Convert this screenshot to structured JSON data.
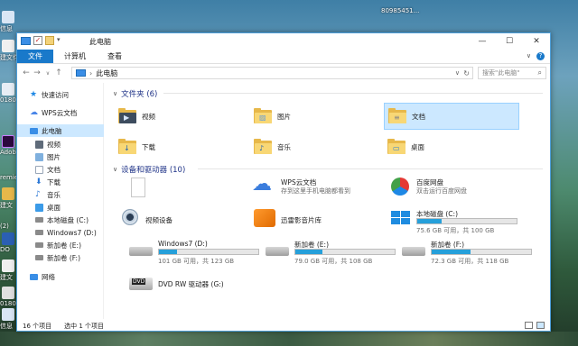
{
  "desktop": {
    "left_labels": [
      "信息",
      "建文件",
      "0180",
      "Adob",
      "remie",
      "建文",
      "(2)",
      "DO",
      "建文",
      "0180",
      "信息",
      "0180"
    ],
    "top_label": "80985451..."
  },
  "window": {
    "title": "此电脑",
    "controls": {
      "minimize": "—",
      "maximize": "☐",
      "close": "✕"
    },
    "ribbon_tabs": [
      "文件",
      "计算机",
      "查看"
    ],
    "ribbon_right": {
      "expand": "∨",
      "help": "?"
    },
    "nav_buttons": {
      "back": "←",
      "forward": "→",
      "recent": "∨",
      "up": "↑"
    },
    "address": {
      "separator": "›",
      "location": "此电脑",
      "dropdown": "∨",
      "refresh": "↻"
    },
    "search": {
      "placeholder": "搜索\"此电脑\"",
      "icon": "⌕"
    }
  },
  "nav_pane": {
    "items": [
      {
        "label": "快速访问",
        "icon": "star-icon",
        "color": "#1e88e5"
      },
      {
        "label": "WPS云文档",
        "icon": "cloud-icon",
        "color": "#4a86e8"
      },
      {
        "label": "此电脑",
        "icon": "computer-icon",
        "color": "#3a8ee6",
        "selected": true
      },
      {
        "label": "视频",
        "icon": "video-folder-icon",
        "color": "#5f6b7a"
      },
      {
        "label": "图片",
        "icon": "pictures-folder-icon",
        "color": "#7fb0de"
      },
      {
        "label": "文档",
        "icon": "documents-folder-icon",
        "color": "#9aa7b8"
      },
      {
        "label": "下载",
        "icon": "download-icon",
        "color": "#2b78d6"
      },
      {
        "label": "音乐",
        "icon": "music-icon",
        "color": "#2b78d6"
      },
      {
        "label": "桌面",
        "icon": "desktop-folder-icon",
        "color": "#3b9be8"
      },
      {
        "label": "本地磁盘 (C:)",
        "icon": "drive-icon",
        "color": "#8a8a8a"
      },
      {
        "label": "Windows7 (D:)",
        "icon": "drive-icon",
        "color": "#8a8a8a"
      },
      {
        "label": "新加卷 (E:)",
        "icon": "drive-icon",
        "color": "#8a8a8a"
      },
      {
        "label": "新加卷 (F:)",
        "icon": "drive-icon",
        "color": "#8a8a8a"
      },
      {
        "label": "网络",
        "icon": "network-icon",
        "color": "#3a8ee6"
      }
    ]
  },
  "folders_group": {
    "title": "文件夹 (6)",
    "items": [
      {
        "label": "视频",
        "glyph": "▶",
        "selected": false
      },
      {
        "label": "图片",
        "glyph": "▨",
        "selected": false
      },
      {
        "label": "文档",
        "glyph": "≡",
        "selected": true
      },
      {
        "label": "下载",
        "glyph": "↓",
        "selected": false
      },
      {
        "label": "音乐",
        "glyph": "♪",
        "selected": false
      },
      {
        "label": "桌面",
        "glyph": "▭",
        "selected": false
      }
    ]
  },
  "devices_group": {
    "title": "设备和驱动器 (10)",
    "items": [
      {
        "name": "",
        "icon": "blank-document-icon"
      },
      {
        "name": "WPS云文档",
        "subtitle": "存到这里手机电脑都看到",
        "icon": "wps-cloud-icon"
      },
      {
        "name": "百度网盘",
        "subtitle": "双击运行百度网盘",
        "icon": "baidu-netdisk-icon"
      },
      {
        "name": "视频设备",
        "icon": "webcam-icon"
      },
      {
        "name": "迅雷影音片库",
        "icon": "xunlei-icon"
      },
      {
        "name": "本地磁盘 (C:)",
        "size": "75.6 GB 可用，共 100 GB",
        "fraction_used": 0.244,
        "icon": "windows-drive-icon"
      },
      {
        "name": "Windows7 (D:)",
        "size": "101 GB 可用，共 123 GB",
        "fraction_used": 0.179,
        "icon": "drive-icon"
      },
      {
        "name": "新加卷 (E:)",
        "size": "79.0 GB 可用，共 108 GB",
        "fraction_used": 0.269,
        "icon": "drive-icon"
      },
      {
        "name": "新加卷 (F:)",
        "size": "72.3 GB 可用，共 118 GB",
        "fraction_used": 0.387,
        "icon": "drive-icon"
      },
      {
        "name": "DVD RW 驱动器 (G:)",
        "icon": "dvd-drive-icon",
        "icon_text": "DVD"
      }
    ]
  },
  "status": {
    "count": "16 个项目",
    "selected": "选中 1 个项目"
  },
  "colors": {
    "accent": "#1979ca",
    "selection": "#cce8ff",
    "group_title": "#1e3287",
    "bar_fill": "#26a0da"
  }
}
